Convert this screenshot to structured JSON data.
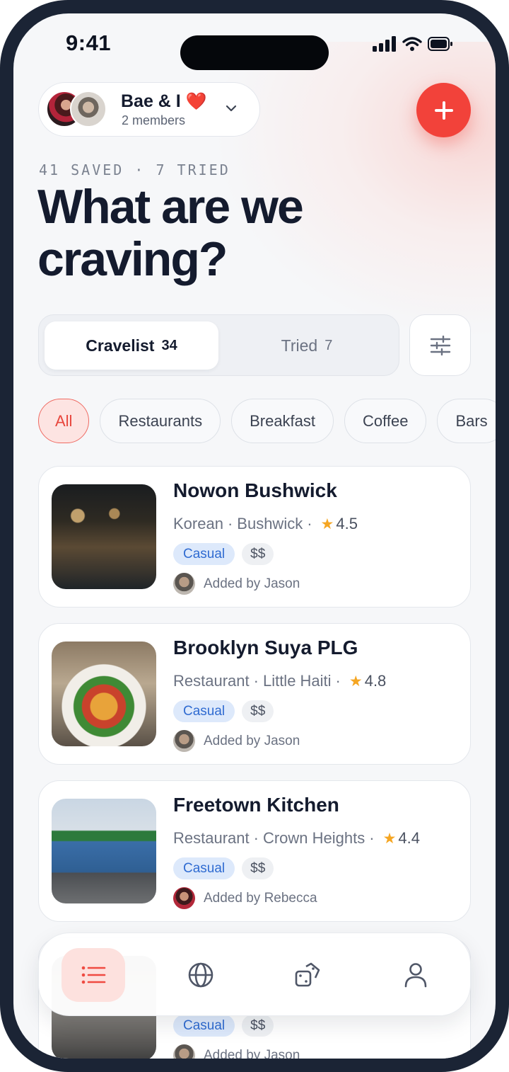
{
  "status_bar": {
    "time": "9:41"
  },
  "group": {
    "name": "Bae & I",
    "emoji": "❤️",
    "members": "2 members"
  },
  "summary": {
    "counts": "41 SAVED · 7 TRIED",
    "headline": "What are we craving?"
  },
  "segmented": {
    "tabs": [
      {
        "label": "Cravelist",
        "count": "34",
        "active": true
      },
      {
        "label": "Tried",
        "count": "7",
        "active": false
      }
    ]
  },
  "categories": [
    {
      "label": "All",
      "active": true
    },
    {
      "label": "Restaurants",
      "active": false
    },
    {
      "label": "Breakfast",
      "active": false
    },
    {
      "label": "Coffee",
      "active": false
    },
    {
      "label": "Bars",
      "active": false
    }
  ],
  "places": [
    {
      "name": "Nowon Bushwick",
      "cuisine": "Korean",
      "area": "Bushwick",
      "rating": "4.5",
      "vibe": "Casual",
      "price": "$$",
      "added_by": "Added by Jason"
    },
    {
      "name": "Brooklyn Suya PLG",
      "cuisine": "Restaurant",
      "area": "Little Haiti",
      "rating": "4.8",
      "vibe": "Casual",
      "price": "$$",
      "added_by": "Added by Jason"
    },
    {
      "name": "Freetown Kitchen",
      "cuisine": "Restaurant",
      "area": "Crown Heights",
      "rating": "4.4",
      "vibe": "Casual",
      "price": "$$",
      "added_by": "Added by Rebecca"
    },
    {
      "name": "",
      "cuisine": "",
      "area": "",
      "rating": "",
      "vibe": "Casual",
      "price": "$$",
      "added_by": "Added by Jason"
    }
  ],
  "tab_bar": {
    "items": [
      {
        "icon": "list-icon",
        "active": true
      },
      {
        "icon": "globe-icon",
        "active": false
      },
      {
        "icon": "dice-icon",
        "active": false
      },
      {
        "icon": "profile-icon",
        "active": false
      }
    ]
  },
  "colors": {
    "accent": "#f2423a",
    "accent_soft": "#fde4e2",
    "tag_blue": "#2f6bd1",
    "star": "#f5a623",
    "text": "#141b2e"
  }
}
